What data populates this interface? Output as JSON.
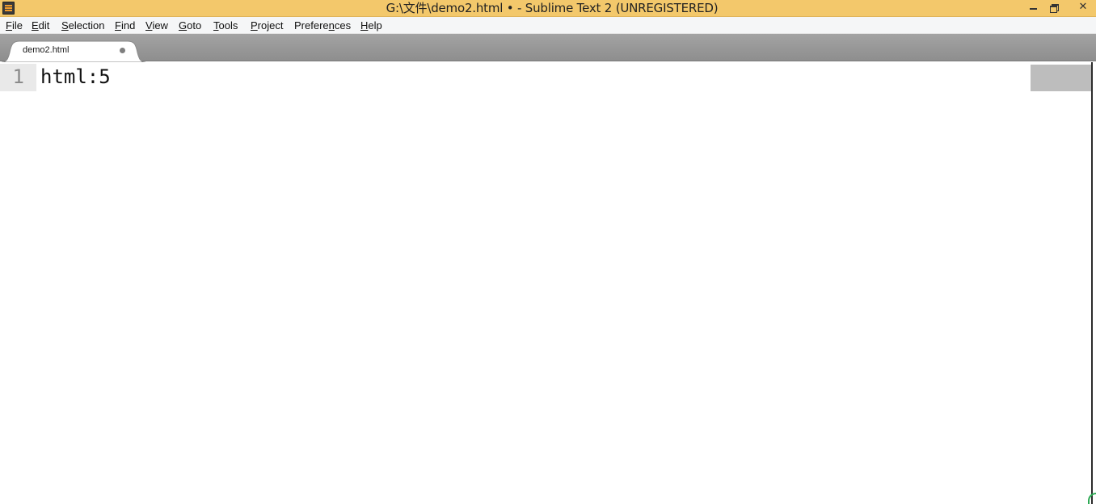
{
  "window": {
    "title": "G:\\文件\\demo2.html • - Sublime Text 2 (UNREGISTERED)",
    "controls": {
      "minimize_icon": "minimize-icon",
      "maximize_icon": "restore-icon",
      "close_icon": "close-icon",
      "close_glyph": "✕"
    },
    "title_bar_color": "#f3c86b"
  },
  "menu": {
    "items": [
      {
        "key": "F",
        "rest": "ile"
      },
      {
        "key": "E",
        "rest": "dit"
      },
      {
        "key": "S",
        "rest": "election"
      },
      {
        "key": "F",
        "rest": "ind",
        "pre": ""
      },
      {
        "key": "V",
        "rest": "iew"
      },
      {
        "key": "G",
        "rest": "oto"
      },
      {
        "key": "T",
        "rest": "ools"
      },
      {
        "key": "P",
        "rest": "roject"
      },
      {
        "pre": "Prefere",
        "key": "n",
        "rest": "ces"
      },
      {
        "key": "H",
        "rest": "elp"
      }
    ]
  },
  "tabs": [
    {
      "label": "demo2.html",
      "modified": true
    }
  ],
  "editor": {
    "lines": [
      {
        "number": "1",
        "text": "html:5"
      }
    ]
  }
}
